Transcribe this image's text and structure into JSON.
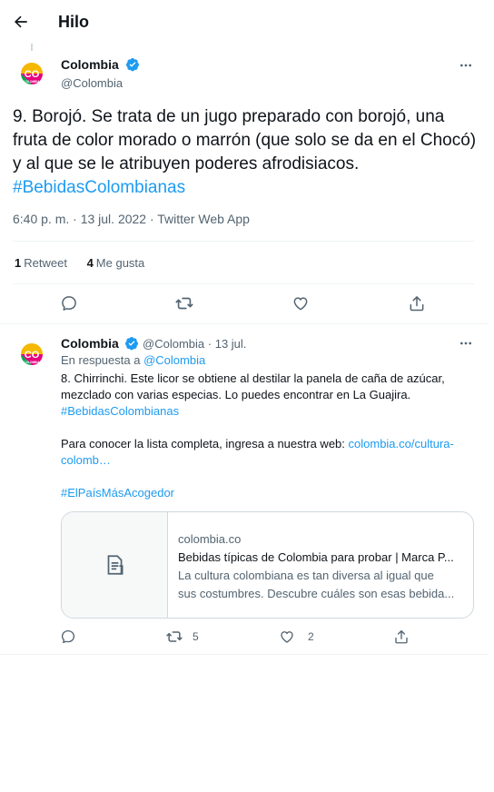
{
  "header": {
    "title": "Hilo"
  },
  "tweet": {
    "display_name": "Colombia",
    "handle": "@Colombia",
    "avatar_text": "CO",
    "avatar_subtext": "COLOMBIA",
    "text": "9. Borojó. Se trata de un jugo preparado con borojó, una fruta de color morado o marrón (que solo se da en el Chocó) y al que se le atribuyen poderes afrodisiacos.",
    "hashtag": "#BebidasColombianas",
    "meta": "6:40 p. m. · 13 jul. 2022 · Twitter Web App",
    "retweets_count": "1",
    "retweets_label": "Retweet",
    "likes_count": "4",
    "likes_label": "Me gusta"
  },
  "reply": {
    "display_name": "Colombia",
    "handle": "@Colombia",
    "date": "· 13 jul.",
    "in_reply_prefix": "En respuesta a",
    "in_reply_handle": "@Colombia",
    "text1": "8. Chirrinchi. Este licor se obtiene al destilar la panela de caña de azúcar, mezclado con varias especias. Lo puedes encontrar en La Guajira.",
    "hashtag1": "#BebidasColombianas",
    "text2_prefix": "Para conocer la lista completa, ingresa a nuestra web:",
    "link_line1": "colombia.co/cultura-",
    "link_line2": "colomb…",
    "hashtag2": "#ElPaísMásAcogedor",
    "card": {
      "domain": "colombia.co",
      "title": "Bebidas típicas de Colombia para probar | Marca P...",
      "desc_line1": "La cultura colombiana es tan diversa al igual que",
      "desc_line2": "sus costumbres. Descubre cuáles son esas bebida..."
    },
    "retweet_count": "5",
    "like_count": "2"
  },
  "colors": {
    "accent": "#1d9bf0",
    "muted": "#536471",
    "border": "#cfd9de"
  }
}
